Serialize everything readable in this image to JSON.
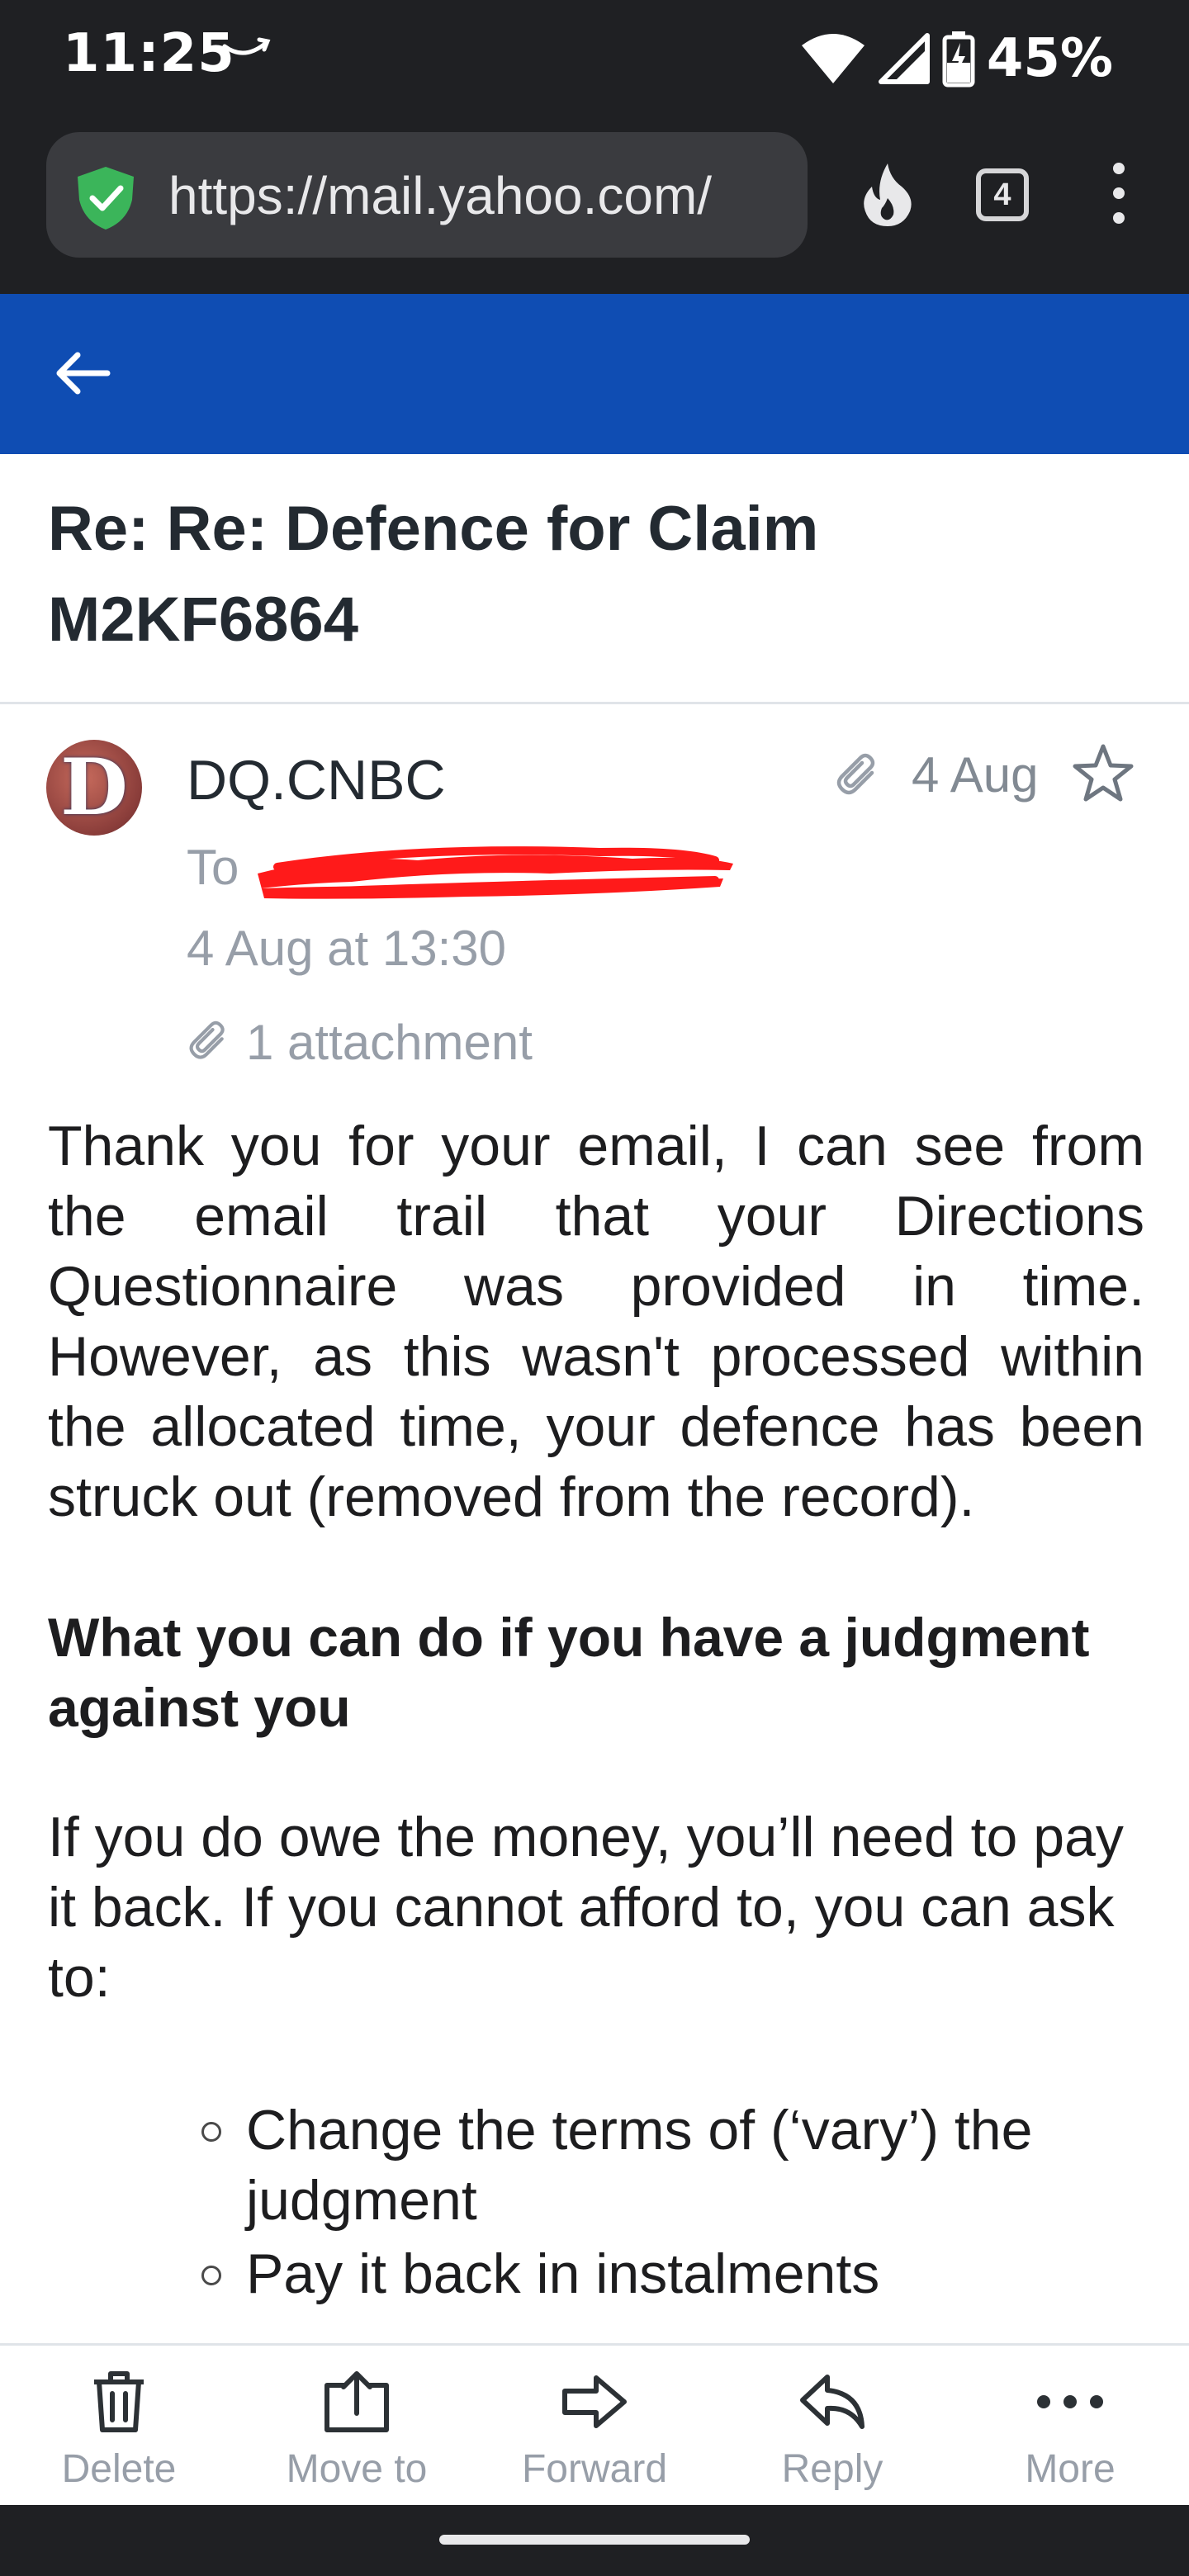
{
  "status_bar": {
    "time": "11:25",
    "battery": "45%",
    "icons": [
      "trail-swoosh-icon",
      "wifi-icon",
      "signal-icon",
      "battery-charging-icon"
    ]
  },
  "browser": {
    "url": "https://mail.yahoo.com/",
    "tab_count": "4",
    "icons": [
      "shield-check-icon",
      "fire-icon",
      "tabs-icon",
      "overflow-menu-icon"
    ]
  },
  "header": {
    "icons": [
      "back-arrow-icon"
    ]
  },
  "email": {
    "subject": "Re: Re: Defence for Claim M2KF6864",
    "avatar_letter": "D",
    "sender": "DQ.CNBC",
    "date_short": "4 Aug",
    "to_label": "To",
    "sent": "4 Aug at 13:30",
    "attachment_label": "1 attachment",
    "body": {
      "para1": "Thank you for your email, I can see from the email trail that your Directions Questionnaire was provided in time. However, as this wasn't processed within the allocated time, your defence has been struck out (removed from the record).",
      "heading": "What you can do if you have a judgment against you",
      "para2": "If you do owe the money, you’ll need to pay it back. If you cannot afford to, you can ask to:",
      "bullets": [
        "Change the terms of (‘vary’) the judgment",
        "Pay it back in instalments"
      ]
    }
  },
  "toolbar": {
    "delete": "Delete",
    "move": "Move to",
    "forward": "Forward",
    "reply": "Reply",
    "more": "More"
  },
  "colors": {
    "header_blue": "#0f4db3",
    "chrome_dark": "#1f2023",
    "secure_green": "#3bb55a",
    "redaction_red": "#ff1a1a"
  }
}
